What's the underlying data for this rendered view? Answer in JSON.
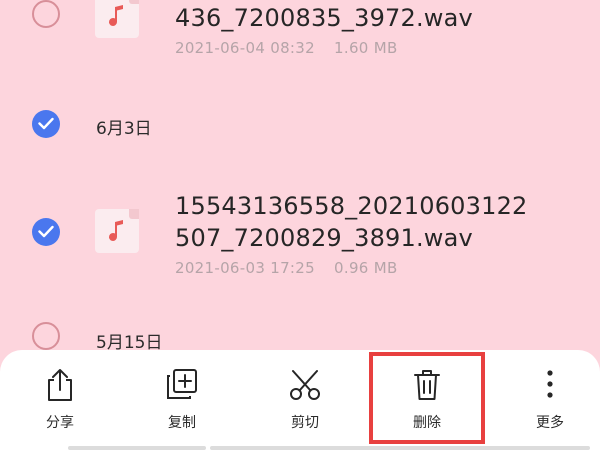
{
  "files": [
    {
      "name_lines": [
        "436_7200835_3972.wav"
      ],
      "date": "2021-06-04 08:32",
      "size": "1.60 MB",
      "selected": false
    },
    {
      "name_lines": [
        "15543136558_20210603122",
        "507_7200829_3891.wav"
      ],
      "date": "2021-06-03 17:25",
      "size": "0.96 MB",
      "selected": true
    }
  ],
  "groups": [
    {
      "label": "6月3日",
      "selected": true
    },
    {
      "label": "5月15日",
      "selected": false
    }
  ],
  "toolbar": {
    "share": "分享",
    "copy": "复制",
    "cut": "剪切",
    "delete": "删除",
    "more": "更多"
  },
  "colors": {
    "background": "#fdd5dd",
    "checkbox_checked": "#4a77ee",
    "highlight": "#e8403f",
    "music_note": "#e85a57"
  },
  "icons": [
    "music-note-icon",
    "checkmark-icon",
    "share-icon",
    "copy-icon",
    "scissors-icon",
    "trash-icon",
    "more-vertical-icon"
  ]
}
